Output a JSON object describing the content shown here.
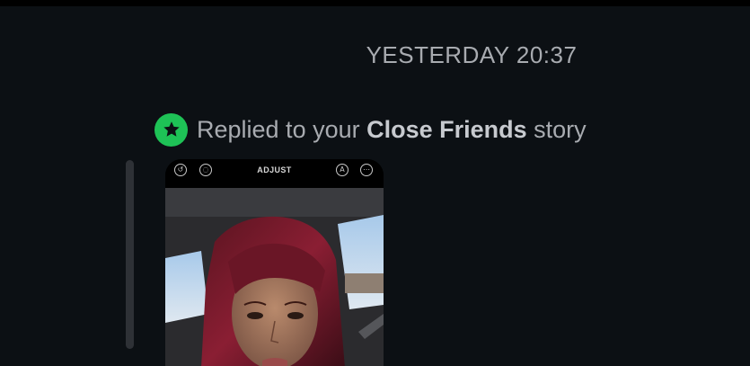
{
  "thread": {
    "timestamp": "YESTERDAY 20:37",
    "reply_notice": {
      "prefix": "Replied to your ",
      "highlight": "Close Friends",
      "suffix": " story",
      "icon": "close-friends-star-icon",
      "icon_color": "#1ec256"
    },
    "story_preview": {
      "toolbar_label": "ADJUST",
      "left_icons": [
        "rotate-icon",
        "crop-icon"
      ],
      "right_icons": [
        "auto-enhance-icon",
        "more-options-icon"
      ]
    }
  },
  "colors": {
    "background": "#0c1014",
    "text_muted": "#a8abb0",
    "quote_bar": "#2e3136"
  }
}
